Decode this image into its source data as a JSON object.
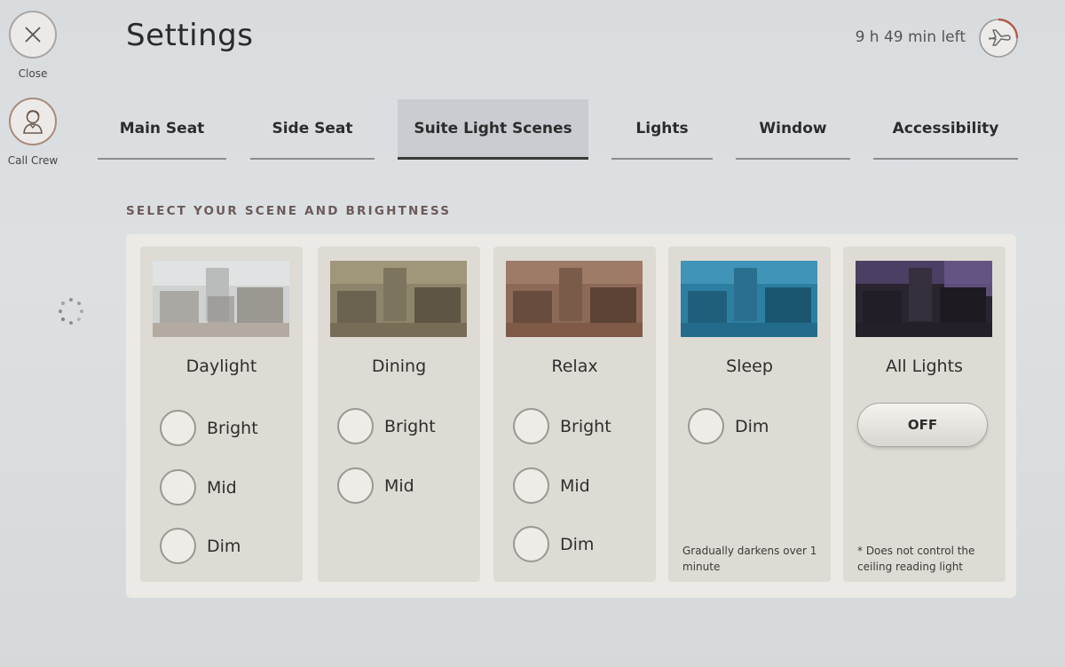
{
  "left_rail": {
    "close_label": "Close",
    "call_crew_label": "Call Crew"
  },
  "header": {
    "title": "Settings",
    "time_left": "9 h 49 min left"
  },
  "tabs": [
    {
      "label": "Main Seat",
      "active": false
    },
    {
      "label": "Side Seat",
      "active": false
    },
    {
      "label": "Suite Light Scenes",
      "active": true
    },
    {
      "label": "Lights",
      "active": false
    },
    {
      "label": "Window",
      "active": false
    },
    {
      "label": "Accessibility",
      "active": false
    }
  ],
  "section_title": "SELECT YOUR SCENE AND BRIGHTNESS",
  "scenes": [
    {
      "name": "Daylight",
      "options": [
        "Bright",
        "Mid",
        "Dim"
      ],
      "tint": "#b9b6ad"
    },
    {
      "name": "Dining",
      "options": [
        "Bright",
        "Mid"
      ],
      "tint": "#8f836a"
    },
    {
      "name": "Relax",
      "options": [
        "Bright",
        "Mid",
        "Dim"
      ],
      "tint": "#8f6a56"
    },
    {
      "name": "Sleep",
      "options": [
        "Dim"
      ],
      "note": "Gradually darkens over 1 minute",
      "tint": "#2f7fa3"
    },
    {
      "name": "All Lights",
      "button": "OFF",
      "note": "* Does not control the ceiling reading light",
      "tint": "#4a3d58"
    }
  ],
  "colors": {
    "background": "#dadde0",
    "panel": "#ebeae6",
    "card": "#dddbd4",
    "active_tab": "#c9ccd0"
  },
  "icons": {
    "close": "close-icon",
    "call_crew": "crew-member-icon",
    "flight_progress": "airplane-icon",
    "loading": "spinner-icon"
  }
}
